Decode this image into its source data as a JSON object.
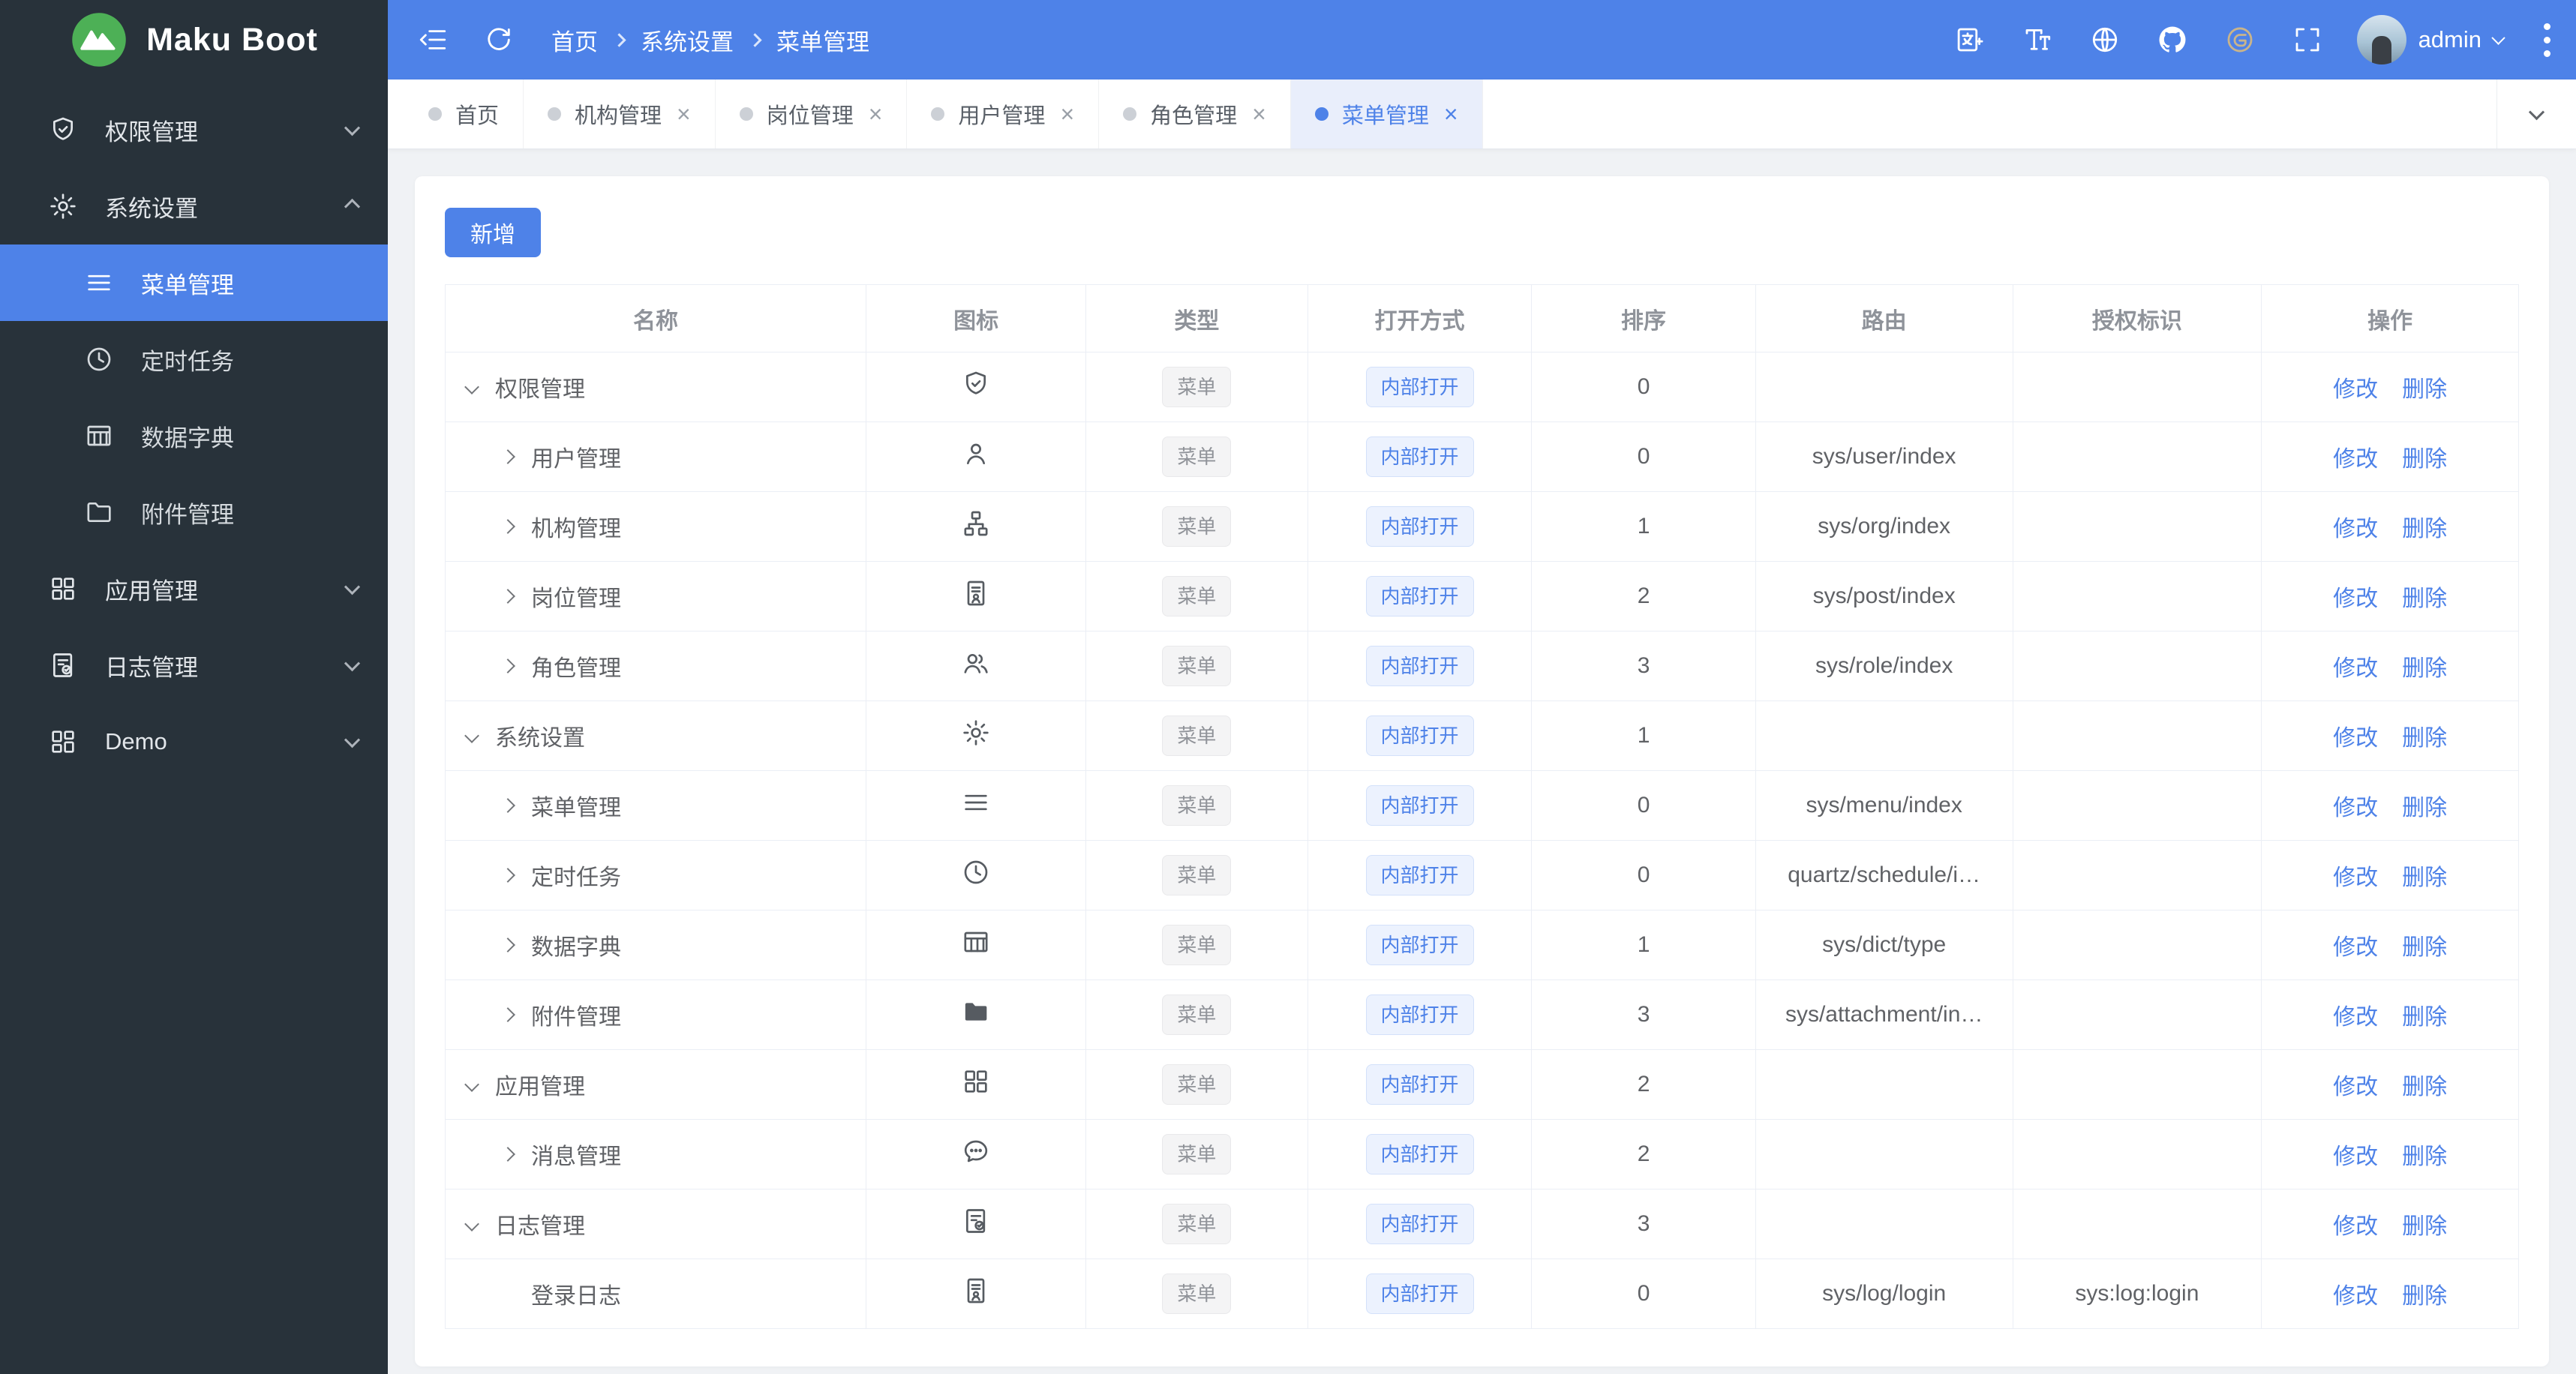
{
  "app": {
    "name": "Maku Boot",
    "logo_icon": "mountain-logo-icon"
  },
  "colors": {
    "primary": "#4e82e8",
    "sidebar_bg": "#28323a",
    "topbar_bg": "#4e82e8",
    "active_tab_bg": "#e9eefb"
  },
  "header": {
    "left_icons": [
      {
        "icon": "fold-menu-icon"
      },
      {
        "icon": "refresh-icon"
      }
    ],
    "breadcrumb": [
      "首页",
      "系统设置",
      "菜单管理"
    ],
    "right_icons": [
      {
        "icon": "translate-icon"
      },
      {
        "icon": "font-size-icon"
      },
      {
        "icon": "globe-icon"
      },
      {
        "icon": "github-icon"
      },
      {
        "icon": "gitee-icon",
        "color": "gold"
      },
      {
        "icon": "fullscreen-icon"
      }
    ],
    "user": {
      "name": "admin",
      "menu_icon": "chevron-down-icon"
    },
    "overflow_icon": "kebab-icon"
  },
  "sidebar": {
    "items": [
      {
        "label": "权限管理",
        "icon": "shield-icon",
        "expand": "down",
        "active": false,
        "children": []
      },
      {
        "label": "系统设置",
        "icon": "gear-icon",
        "expand": "up",
        "active": false,
        "children": [
          {
            "label": "菜单管理",
            "icon": "menu-icon",
            "active": true
          },
          {
            "label": "定时任务",
            "icon": "clock-icon",
            "active": false
          },
          {
            "label": "数据字典",
            "icon": "dict-icon",
            "active": false
          },
          {
            "label": "附件管理",
            "icon": "folder-icon",
            "active": false
          }
        ]
      },
      {
        "label": "应用管理",
        "icon": "apps-icon",
        "expand": "down",
        "active": false,
        "children": []
      },
      {
        "label": "日志管理",
        "icon": "log-icon",
        "expand": "down",
        "active": false,
        "children": []
      },
      {
        "label": "Demo",
        "icon": "demo-icon",
        "expand": "down",
        "active": false,
        "children": []
      }
    ]
  },
  "tabbar": {
    "tabs": [
      {
        "label": "首页",
        "closable": false,
        "active": false
      },
      {
        "label": "机构管理",
        "closable": true,
        "active": false
      },
      {
        "label": "岗位管理",
        "closable": true,
        "active": false
      },
      {
        "label": "用户管理",
        "closable": true,
        "active": false
      },
      {
        "label": "角色管理",
        "closable": true,
        "active": false
      },
      {
        "label": "菜单管理",
        "closable": true,
        "active": true
      }
    ],
    "overflow_icon": "chevron-down-icon"
  },
  "toolbar": {
    "add_label": "新增"
  },
  "menu_table": {
    "headers": [
      "名称",
      "图标",
      "类型",
      "打开方式",
      "排序",
      "路由",
      "授权标识",
      "操作"
    ],
    "col_widths": [
      "20.3%",
      "10.6%",
      "10.7%",
      "10.8%",
      "10.8%",
      "12.4%",
      "12.0%",
      "12.4%"
    ],
    "type_tag": "菜单",
    "open_tag": "内部打开",
    "edit_label": "修改",
    "delete_label": "删除",
    "rows": [
      {
        "name": "权限管理",
        "level": 1,
        "chevron": "down",
        "icon": "shield-icon",
        "sort": "0",
        "route": "",
        "auth": ""
      },
      {
        "name": "用户管理",
        "level": 2,
        "chevron": "right",
        "icon": "user-icon",
        "sort": "0",
        "route": "sys/user/index",
        "auth": ""
      },
      {
        "name": "机构管理",
        "level": 2,
        "chevron": "right",
        "icon": "org-icon",
        "sort": "1",
        "route": "sys/org/index",
        "auth": ""
      },
      {
        "name": "岗位管理",
        "level": 2,
        "chevron": "right",
        "icon": "post-icon",
        "sort": "2",
        "route": "sys/post/index",
        "auth": ""
      },
      {
        "name": "角色管理",
        "level": 2,
        "chevron": "right",
        "icon": "role-icon",
        "sort": "3",
        "route": "sys/role/index",
        "auth": ""
      },
      {
        "name": "系统设置",
        "level": 1,
        "chevron": "down",
        "icon": "gear-icon",
        "sort": "1",
        "route": "",
        "auth": ""
      },
      {
        "name": "菜单管理",
        "level": 2,
        "chevron": "right",
        "icon": "menu-icon",
        "sort": "0",
        "route": "sys/menu/index",
        "auth": ""
      },
      {
        "name": "定时任务",
        "level": 2,
        "chevron": "right",
        "icon": "clock-icon",
        "sort": "0",
        "route": "quartz/schedule/i…",
        "auth": ""
      },
      {
        "name": "数据字典",
        "level": 2,
        "chevron": "right",
        "icon": "dict-icon",
        "sort": "1",
        "route": "sys/dict/type",
        "auth": ""
      },
      {
        "name": "附件管理",
        "level": 2,
        "chevron": "right",
        "icon": "folder-filled-icon",
        "sort": "3",
        "route": "sys/attachment/in…",
        "auth": ""
      },
      {
        "name": "应用管理",
        "level": 1,
        "chevron": "down",
        "icon": "apps-icon",
        "sort": "2",
        "route": "",
        "auth": ""
      },
      {
        "name": "消息管理",
        "level": 2,
        "chevron": "right",
        "icon": "message-icon",
        "sort": "2",
        "route": "",
        "auth": ""
      },
      {
        "name": "日志管理",
        "level": 1,
        "chevron": "down",
        "icon": "log-icon",
        "sort": "3",
        "route": "",
        "auth": ""
      },
      {
        "name": "登录日志",
        "level": 2,
        "chevron": "none",
        "icon": "post-icon",
        "sort": "0",
        "route": "sys/log/login",
        "auth": "sys:log:login"
      }
    ]
  }
}
